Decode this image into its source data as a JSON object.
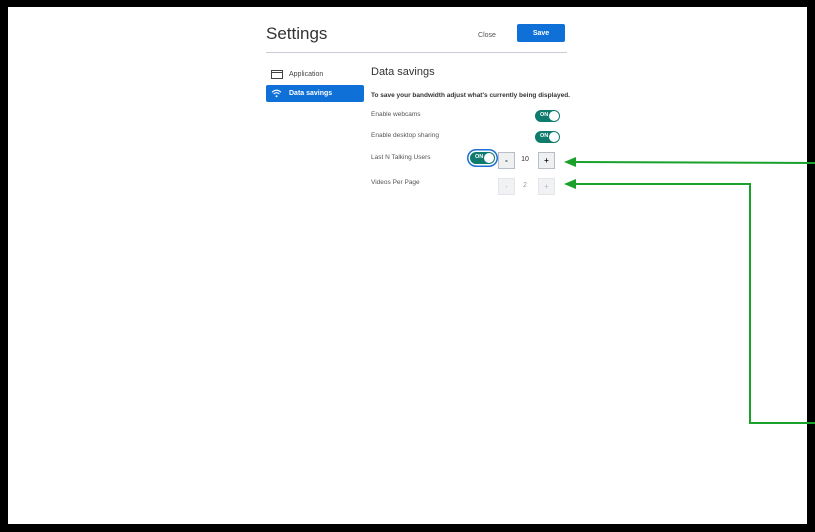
{
  "header": {
    "title": "Settings",
    "close_label": "Close",
    "save_label": "Save"
  },
  "sidebar": {
    "items": [
      {
        "label": "Application",
        "icon": "application-icon",
        "active": false
      },
      {
        "label": "Data savings",
        "icon": "wifi-icon",
        "active": true
      }
    ]
  },
  "main": {
    "section_title": "Data savings",
    "description": "To save your bandwidth adjust what's currently being displayed.",
    "rows": [
      {
        "label": "Enable webcams",
        "toggle": "ON"
      },
      {
        "label": "Enable desktop sharing",
        "toggle": "ON"
      },
      {
        "label": "Last N Talking Users",
        "toggle": "ON",
        "decrement": "-",
        "value": "10",
        "increment": "+"
      },
      {
        "label": "Videos Per Page",
        "decrement": "-",
        "value": "2",
        "increment": "+"
      }
    ]
  },
  "colors": {
    "accent": "#0f70d7",
    "toggle_on": "#0f7b6c",
    "annotation_arrow": "#1aa12b",
    "frame": "#000000"
  }
}
